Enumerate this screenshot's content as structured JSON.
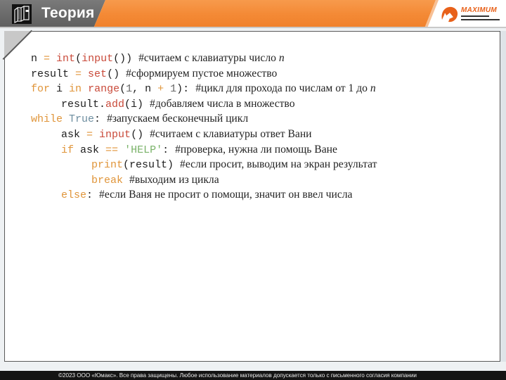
{
  "header": {
    "title": "Теория",
    "icon": "books-icon",
    "colors": {
      "gray": "#6a6a6a",
      "orange": "#f48a36"
    }
  },
  "brand": {
    "name": "MAXIMUM",
    "icon": "maximum-logo-icon",
    "color": "#e8611a"
  },
  "code": {
    "lines": [
      {
        "indent": 0,
        "tokens": [
          {
            "t": "n ",
            "c": "mono"
          },
          {
            "t": "=",
            "c": "mono op"
          },
          {
            "t": " ",
            "c": "mono"
          },
          {
            "t": "int",
            "c": "mono fn"
          },
          {
            "t": "(",
            "c": "mono"
          },
          {
            "t": "input",
            "c": "mono fn"
          },
          {
            "t": "()) ",
            "c": "mono"
          },
          {
            "t": "#считаем с клавиатуры число ",
            "c": "cmt"
          },
          {
            "t": "n",
            "c": "cmt it"
          }
        ]
      },
      {
        "indent": 0,
        "tokens": [
          {
            "t": "result ",
            "c": "mono"
          },
          {
            "t": "=",
            "c": "mono op"
          },
          {
            "t": " ",
            "c": "mono"
          },
          {
            "t": "set",
            "c": "mono fn"
          },
          {
            "t": "() ",
            "c": "mono"
          },
          {
            "t": "#сформируем пустое множество",
            "c": "cmt"
          }
        ]
      },
      {
        "indent": 0,
        "tokens": [
          {
            "t": "for",
            "c": "mono kw"
          },
          {
            "t": " i ",
            "c": "mono"
          },
          {
            "t": "in",
            "c": "mono kw"
          },
          {
            "t": " ",
            "c": "mono"
          },
          {
            "t": "range",
            "c": "mono fn"
          },
          {
            "t": "(",
            "c": "mono"
          },
          {
            "t": "1",
            "c": "mono num"
          },
          {
            "t": ", n ",
            "c": "mono"
          },
          {
            "t": "+",
            "c": "mono op"
          },
          {
            "t": " ",
            "c": "mono"
          },
          {
            "t": "1",
            "c": "mono num"
          },
          {
            "t": "): ",
            "c": "mono"
          },
          {
            "t": "#цикл для прохода по числам от 1 до ",
            "c": "cmt"
          },
          {
            "t": "n",
            "c": "cmt it"
          }
        ]
      },
      {
        "indent": 1,
        "tokens": [
          {
            "t": "result.",
            "c": "mono"
          },
          {
            "t": "add",
            "c": "mono fn"
          },
          {
            "t": "(i) ",
            "c": "mono"
          },
          {
            "t": "#добавляем числа в множество",
            "c": "cmt"
          }
        ]
      },
      {
        "indent": 0,
        "tokens": [
          {
            "t": "while",
            "c": "mono kw"
          },
          {
            "t": " ",
            "c": "mono"
          },
          {
            "t": "True",
            "c": "mono lit"
          },
          {
            "t": ": ",
            "c": "mono"
          },
          {
            "t": "#запускаем бесконечный цикл",
            "c": "cmt"
          }
        ]
      },
      {
        "indent": 1,
        "tokens": [
          {
            "t": "ask ",
            "c": "mono"
          },
          {
            "t": "=",
            "c": "mono op"
          },
          {
            "t": " ",
            "c": "mono"
          },
          {
            "t": "input",
            "c": "mono fn"
          },
          {
            "t": "() ",
            "c": "mono"
          },
          {
            "t": "#считаем с клавиатуры ответ Вани",
            "c": "cmt"
          }
        ]
      },
      {
        "indent": 1,
        "tokens": [
          {
            "t": "if",
            "c": "mono kw"
          },
          {
            "t": " ask ",
            "c": "mono"
          },
          {
            "t": "==",
            "c": "mono op"
          },
          {
            "t": " ",
            "c": "mono"
          },
          {
            "t": "'HELP'",
            "c": "mono str"
          },
          {
            "t": ": ",
            "c": "mono"
          },
          {
            "t": "#проверка, нужна ли помощь Ване",
            "c": "cmt"
          }
        ]
      },
      {
        "indent": 2,
        "tokens": [
          {
            "t": "print",
            "c": "mono kw"
          },
          {
            "t": "(result) ",
            "c": "mono"
          },
          {
            "t": "#если просит, выводим на экран результат",
            "c": "cmt"
          }
        ]
      },
      {
        "indent": 2,
        "tokens": [
          {
            "t": "break",
            "c": "mono kw"
          },
          {
            "t": " ",
            "c": "mono"
          },
          {
            "t": "#выходим из цикла",
            "c": "cmt"
          }
        ]
      },
      {
        "indent": 1,
        "tokens": [
          {
            "t": "else",
            "c": "mono kw"
          },
          {
            "t": ": ",
            "c": "mono"
          },
          {
            "t": "#если Ваня не просит о помощи, значит он ввел числа",
            "c": "cmt"
          }
        ]
      }
    ]
  },
  "footer": {
    "text": "©2023 ООО «Юмакс». Все права защищены. Любое использование материалов допускается только с  письменного согласия компании"
  }
}
